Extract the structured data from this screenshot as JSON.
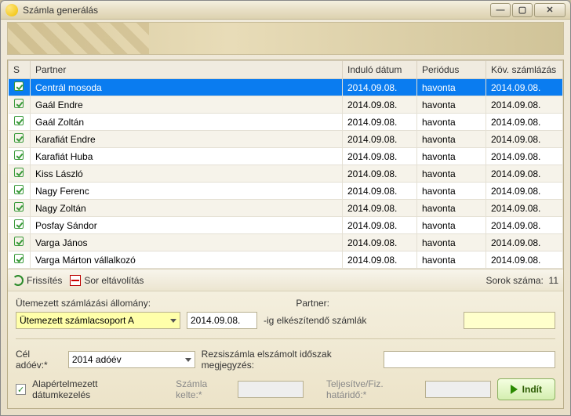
{
  "window": {
    "title": "Számla generálás"
  },
  "columns": {
    "s": "S",
    "partner": "Partner",
    "start": "Induló dátum",
    "period": "Periódus",
    "next": "Köv. számlázás"
  },
  "rows": [
    {
      "partner": "Centrál mosoda",
      "start": "2014.09.08.",
      "period": "havonta",
      "next": "2014.09.08.",
      "selected": true
    },
    {
      "partner": "Gaál Endre",
      "start": "2014.09.08.",
      "period": "havonta",
      "next": "2014.09.08."
    },
    {
      "partner": "Gaál Zoltán",
      "start": "2014.09.08.",
      "period": "havonta",
      "next": "2014.09.08."
    },
    {
      "partner": "Karafiát Endre",
      "start": "2014.09.08.",
      "period": "havonta",
      "next": "2014.09.08."
    },
    {
      "partner": "Karafiát Huba",
      "start": "2014.09.08.",
      "period": "havonta",
      "next": "2014.09.08."
    },
    {
      "partner": "Kiss László",
      "start": "2014.09.08.",
      "period": "havonta",
      "next": "2014.09.08."
    },
    {
      "partner": "Nagy Ferenc",
      "start": "2014.09.08.",
      "period": "havonta",
      "next": "2014.09.08."
    },
    {
      "partner": "Nagy Zoltán",
      "start": "2014.09.08.",
      "period": "havonta",
      "next": "2014.09.08."
    },
    {
      "partner": "Posfay Sándor",
      "start": "2014.09.08.",
      "period": "havonta",
      "next": "2014.09.08."
    },
    {
      "partner": "Varga János",
      "start": "2014.09.08.",
      "period": "havonta",
      "next": "2014.09.08."
    },
    {
      "partner": "Varga Márton vállalkozó",
      "start": "2014.09.08.",
      "period": "havonta",
      "next": "2014.09.08."
    }
  ],
  "toolbar": {
    "refresh": "Frissítés",
    "remove": "Sor eltávolítás",
    "rowcount_label": "Sorok száma:",
    "rowcount": "11"
  },
  "panel": {
    "sched_label": "Ütemezett számlázási állomány:",
    "sched_value": "Ütemezett számlacsoport A",
    "date_value": "2014.09.08.",
    "date_suffix": "-ig elkészítendő számlák",
    "partner_label": "Partner:",
    "taxyear_label": "Cél adóév:*",
    "taxyear_value": "2014 adóév",
    "note_label": "Rezsiszámla elszámolt időszak megjegyzés:",
    "defaultdate_label": "Alapértelmezett dátumkezelés",
    "issue_label": "Számla kelte:*",
    "due_label": "Teljesítve/Fiz. határidő:*",
    "run": "Indít"
  }
}
